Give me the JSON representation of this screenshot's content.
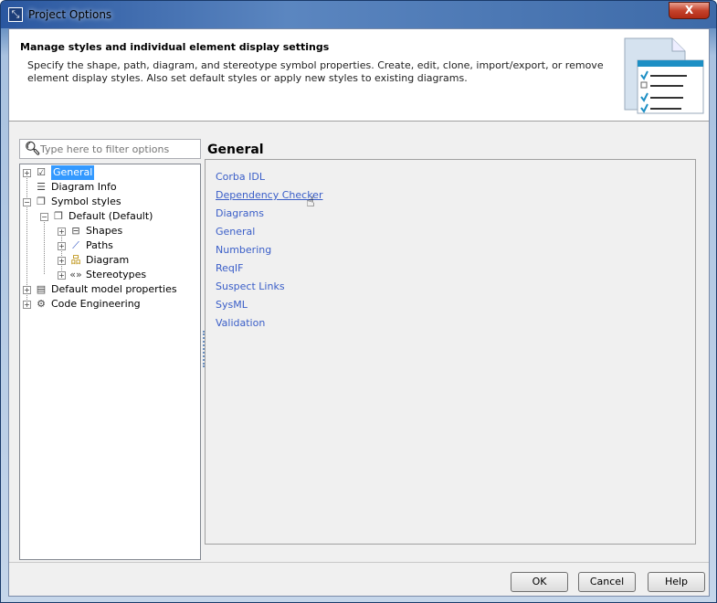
{
  "window": {
    "title": "Project Options",
    "close_label": "X"
  },
  "header": {
    "title": "Manage styles and individual element display settings",
    "description": "Specify the shape, path, diagram, and stereotype symbol properties. Create, edit, clone, import/export, or remove element display styles. Also set default styles or apply new styles to existing diagrams."
  },
  "filter": {
    "placeholder": "Type here to filter options",
    "value": ""
  },
  "tree": [
    {
      "label": "General",
      "icon": "checkbox-icon",
      "expander": "+",
      "selected": true
    },
    {
      "label": "Diagram Info",
      "icon": "table-icon",
      "expander": ""
    },
    {
      "label": "Symbol styles",
      "icon": "styles-icon",
      "expander": "-"
    },
    {
      "label": "Default (Default)",
      "icon": "styles-icon",
      "expander": "-"
    },
    {
      "label": "Shapes",
      "icon": "shapes-icon",
      "expander": "+"
    },
    {
      "label": "Paths",
      "icon": "path-icon",
      "expander": "+"
    },
    {
      "label": "Diagram",
      "icon": "diagram-icon",
      "expander": "+"
    },
    {
      "label": "Stereotypes",
      "icon": "stereotype-icon",
      "expander": "+"
    },
    {
      "label": "Default model properties",
      "icon": "properties-icon",
      "expander": "+"
    },
    {
      "label": "Code Engineering",
      "icon": "code-engineering-icon",
      "expander": "+"
    }
  ],
  "panel": {
    "title": "General",
    "links": [
      "Corba IDL",
      "Dependency Checker",
      "Diagrams",
      "General",
      "Numbering",
      "ReqIF",
      "Suspect Links",
      "SysML",
      "Validation"
    ],
    "link_color": "#3a5ec8",
    "hovered": "Dependency Checker"
  },
  "buttons": {
    "ok": "OK",
    "cancel": "Cancel",
    "help": "Help"
  }
}
